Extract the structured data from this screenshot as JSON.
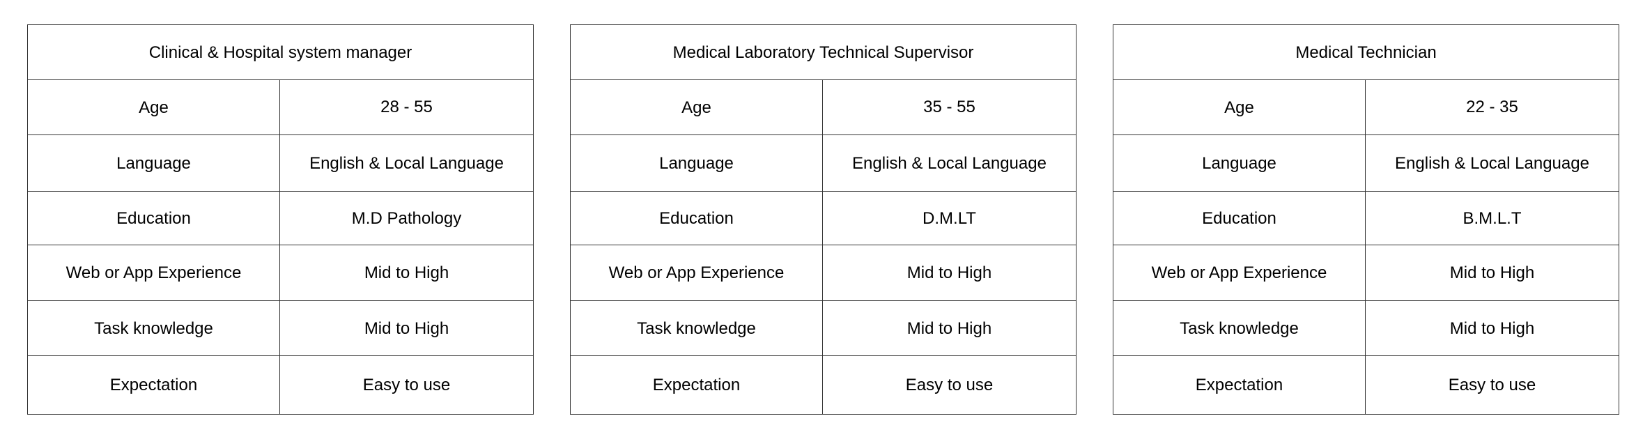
{
  "personas": [
    {
      "title": "Clinical & Hospital system manager",
      "rows": [
        {
          "label": "Age",
          "value": "28 - 55"
        },
        {
          "label": "Language",
          "value": "English & Local Language"
        },
        {
          "label": "Education",
          "value": "M.D Pathology"
        },
        {
          "label": "Web or App Experience",
          "value": "Mid to High"
        },
        {
          "label": "Task knowledge",
          "value": "Mid to High"
        },
        {
          "label": "Expectation",
          "value": "Easy to use"
        }
      ]
    },
    {
      "title": "Medical Laboratory Technical Supervisor",
      "rows": [
        {
          "label": "Age",
          "value": "35 - 55"
        },
        {
          "label": "Language",
          "value": "English & Local Language"
        },
        {
          "label": "Education",
          "value": "D.M.LT"
        },
        {
          "label": "Web or App Experience",
          "value": "Mid to High"
        },
        {
          "label": "Task knowledge",
          "value": "Mid to High"
        },
        {
          "label": "Expectation",
          "value": "Easy to use"
        }
      ]
    },
    {
      "title": "Medical Technician",
      "rows": [
        {
          "label": "Age",
          "value": "22 - 35"
        },
        {
          "label": "Language",
          "value": "English & Local Language"
        },
        {
          "label": "Education",
          "value": "B.M.L.T"
        },
        {
          "label": "Web or App Experience",
          "value": "Mid to High"
        },
        {
          "label": "Task knowledge",
          "value": "Mid to High"
        },
        {
          "label": "Expectation",
          "value": "Easy to use"
        }
      ]
    }
  ]
}
